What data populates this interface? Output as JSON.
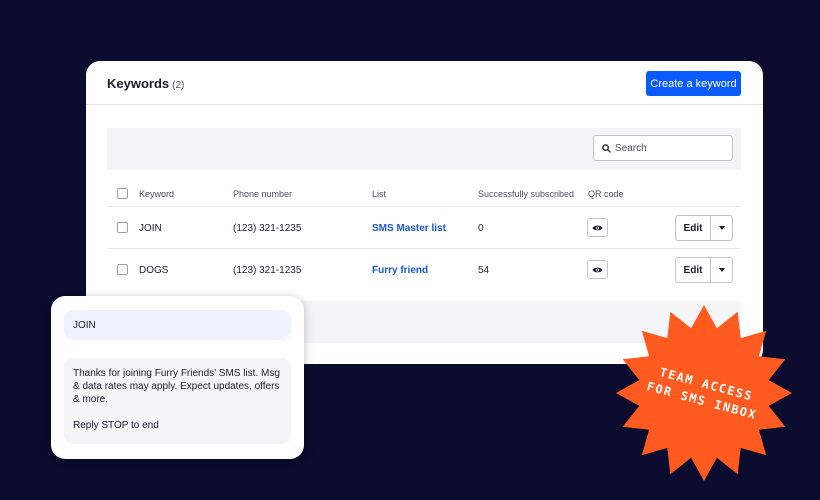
{
  "card": {
    "title": "Keywords",
    "count": "(2)",
    "create_label": "Create a keyword"
  },
  "search": {
    "placeholder": "Search"
  },
  "table": {
    "headers": [
      "Keyword",
      "Phone number",
      "List",
      "Successfully subscribed",
      "QR code"
    ],
    "rows": [
      {
        "keyword": "JOIN",
        "phone": "(123) 321-1235",
        "list": "SMS Master list",
        "subscribed": "0",
        "edit": "Edit"
      },
      {
        "keyword": "DOGS",
        "phone": "(123) 321-1235",
        "list": "Furry friend",
        "subscribed": "54",
        "edit": "Edit"
      }
    ]
  },
  "sms": {
    "incoming": "JOIN",
    "reply_line1": "Thanks for joining Furry Friends’ SMS list. Msg & data rates may apply. Expect updates, offers & more.",
    "reply_line2": "Reply STOP to end"
  },
  "badge": {
    "line1": "TEAM ACCESS",
    "line2": "FOR SMS INBOX",
    "color": "#ff5a1f"
  },
  "colors": {
    "background": "#0b0c2e",
    "accent": "#0a5bff",
    "link": "#1b56d6"
  },
  "icons": [
    "search-icon",
    "eye-icon",
    "chevron-down-icon"
  ]
}
